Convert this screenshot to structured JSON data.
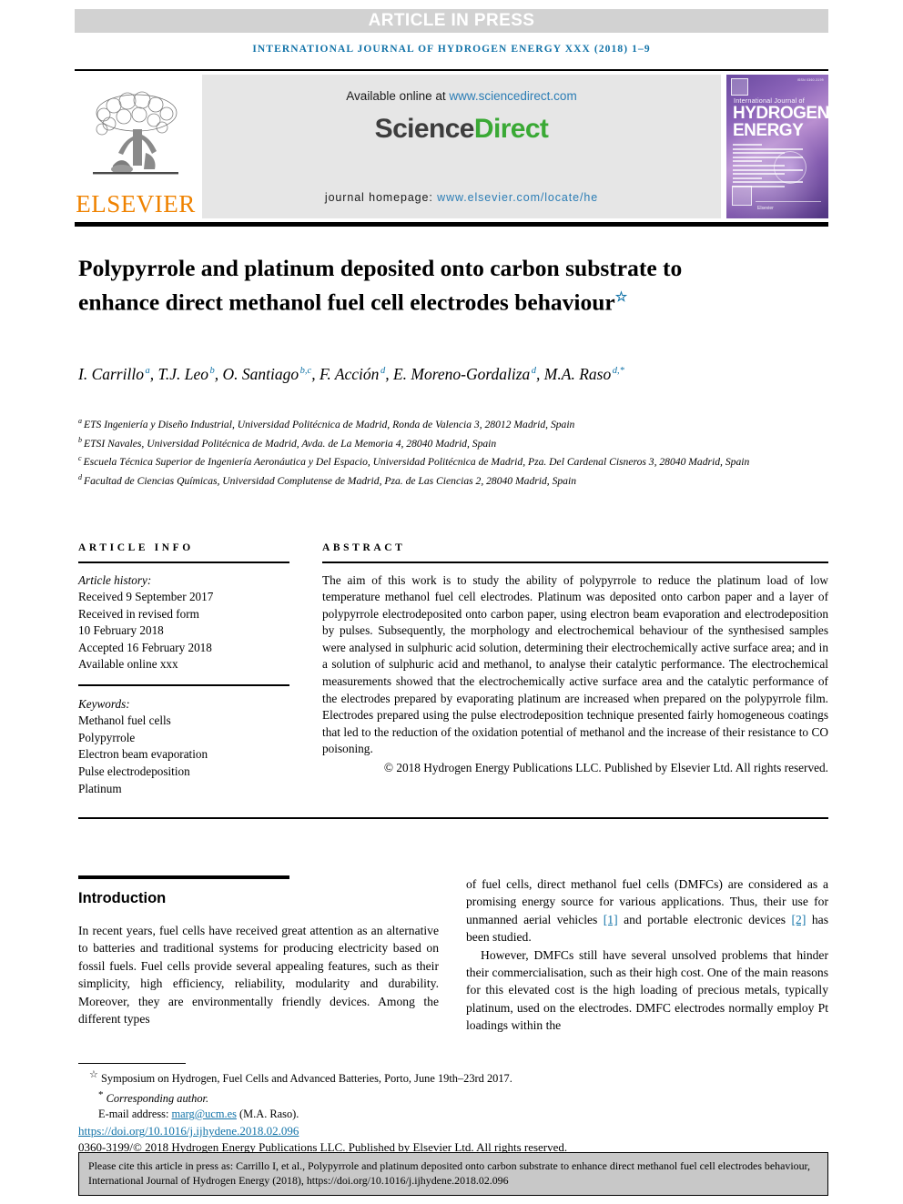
{
  "banner": {
    "text": "ARTICLE IN PRESS"
  },
  "running_head": "International Journal of Hydrogen Energy xxx (2018) 1–9",
  "masthead": {
    "elsevier_wordmark": "ELSEVIER",
    "available_prefix": "Available online at ",
    "available_url": "www.sciencedirect.com",
    "sciencedirect_part1": "Science",
    "sciencedirect_part2": "Direct",
    "homepage_prefix": "journal homepage: ",
    "homepage_url": "www.elsevier.com/locate/he",
    "cover": {
      "issn": "ISSN 0360-3199",
      "line_ij": "International Journal of",
      "line_h1": "HYDROGEN",
      "line_h2": "ENERGY",
      "publisher": "Elsevier"
    }
  },
  "article": {
    "title": "Polypyrrole and platinum deposited onto carbon substrate to enhance direct methanol fuel cell electrodes behaviour",
    "title_marker": "☆",
    "authors": [
      {
        "name": "I. Carrillo",
        "sup": "a",
        "sep": ", "
      },
      {
        "name": "T.J. Leo",
        "sup": "b",
        "sep": ", "
      },
      {
        "name": "O. Santiago",
        "sup": "b,c",
        "sep": ", "
      },
      {
        "name": "F. Acción",
        "sup": "d",
        "sep": ", "
      },
      {
        "name": "E. Moreno-Gordaliza",
        "sup": "d",
        "sep": ", "
      },
      {
        "name": "M.A. Raso",
        "sup": "d,*",
        "sep": ""
      }
    ],
    "affiliations": [
      {
        "mark": "a",
        "text": "ETS Ingeniería y Diseño Industrial, Universidad Politécnica de Madrid, Ronda de Valencia 3, 28012 Madrid, Spain"
      },
      {
        "mark": "b",
        "text": "ETSI Navales, Universidad Politécnica de Madrid, Avda. de La Memoria 4, 28040 Madrid, Spain"
      },
      {
        "mark": "c",
        "text": "Escuela Técnica Superior de Ingeniería Aeronáutica y Del Espacio, Universidad Politécnica de Madrid, Pza. Del Cardenal Cisneros 3, 28040 Madrid, Spain"
      },
      {
        "mark": "d",
        "text": "Facultad de Ciencias Químicas, Universidad Complutense de Madrid, Pza. de Las Ciencias 2, 28040 Madrid, Spain"
      }
    ]
  },
  "article_info": {
    "heading": "ARTICLE INFO",
    "history_title": "Article history:",
    "history": [
      "Received 9 September 2017",
      "Received in revised form",
      "10 February 2018",
      "Accepted 16 February 2018",
      "Available online xxx"
    ],
    "keywords_title": "Keywords:",
    "keywords": [
      "Methanol fuel cells",
      "Polypyrrole",
      "Electron beam evaporation",
      "Pulse electrodeposition",
      "Platinum"
    ]
  },
  "abstract": {
    "heading": "ABSTRACT",
    "body": "The aim of this work is to study the ability of polypyrrole to reduce the platinum load of low temperature methanol fuel cell electrodes. Platinum was deposited onto carbon paper and a layer of polypyrrole electrodeposited onto carbon paper, using electron beam evaporation and electrodeposition by pulses. Subsequently, the morphology and electrochemical behaviour of the synthesised samples were analysed in sulphuric acid solution, determining their electrochemically active surface area; and in a solution of sulphuric acid and methanol, to analyse their catalytic performance. The electrochemical measurements showed that the electrochemically active surface area and the catalytic performance of the electrodes prepared by evaporating platinum are increased when prepared on the polypyrrole film. Electrodes prepared using the pulse electrodeposition technique presented fairly homogeneous coatings that led to the reduction of the oxidation potential of methanol and the increase of their resistance to CO poisoning.",
    "copyright": "© 2018 Hydrogen Energy Publications LLC. Published by Elsevier Ltd. All rights reserved."
  },
  "introduction": {
    "heading": "Introduction",
    "paragraph_1_left": "In recent years, fuel cells have received great attention as an alternative to batteries and traditional systems for producing electricity based on fossil fuels. Fuel cells provide several appealing features, such as their simplicity, high efficiency, reliability, modularity and durability. Moreover, they are environmentally friendly devices. Among the different types",
    "paragraph_1_right_a": "of fuel cells, direct methanol fuel cells (DMFCs) are considered as a promising energy source for various applications. Thus, their use for unmanned aerial vehicles ",
    "paragraph_1_ref_1": "[1]",
    "paragraph_1_right_b": " and portable electronic devices ",
    "paragraph_1_ref_2": "[2]",
    "paragraph_1_right_c": " has been studied.",
    "paragraph_2_right": "However, DMFCs still have several unsolved problems that hinder their commercialisation, such as their high cost. One of the main reasons for this elevated cost is the high loading of precious metals, typically platinum, used on the electrodes. DMFC electrodes normally employ Pt loadings within the"
  },
  "footnotes": {
    "symposium_marker": "☆",
    "symposium": "Symposium on Hydrogen, Fuel Cells and Advanced Batteries, Porto, June 19th–23rd 2017.",
    "corresponding_marker": "*",
    "corresponding": "Corresponding author.",
    "email_label": "E-mail address: ",
    "email": "marg@ucm.es",
    "email_suffix": " (M.A. Raso).",
    "doi": "https://doi.org/10.1016/j.ijhydene.2018.02.096",
    "issn_copyright": "0360-3199/© 2018 Hydrogen Energy Publications LLC. Published by Elsevier Ltd. All rights reserved."
  },
  "cite_box": {
    "text": "Please cite this article in press as: Carrillo I, et al., Polypyrrole and platinum deposited onto carbon substrate to enhance direct methanol fuel cell electrodes behaviour, International Journal of Hydrogen Energy (2018), https://doi.org/10.1016/j.ijhydene.2018.02.096"
  },
  "colors": {
    "link": "#2b7db5",
    "journal_blue": "#1273a8",
    "elsevier_orange": "#ef8200",
    "sciencedirect_green": "#3aa935",
    "banner_grey": "#d2d2d2",
    "cite_box_grey": "#c8c8c8"
  }
}
